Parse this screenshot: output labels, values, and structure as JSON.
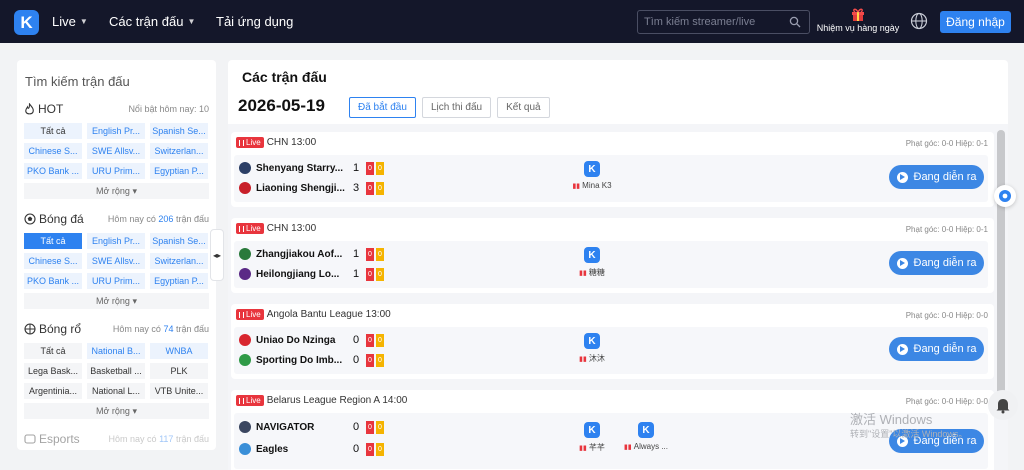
{
  "topbar": {
    "logo": "K",
    "nav": [
      {
        "label": "Live",
        "dropdown": true
      },
      {
        "label": "Các trận đấu",
        "dropdown": true
      },
      {
        "label": "Tải ứng dụng",
        "dropdown": false
      }
    ],
    "search_placeholder": "Tìm kiếm streamer/live",
    "mission_label": "Nhiệm vụ hàng ngày",
    "login_label": "Đăng nhập",
    "icons": [
      "search-icon",
      "gift-icon",
      "globe-icon"
    ]
  },
  "sidebar": {
    "title": "Tìm kiếm trận đấu",
    "sections": {
      "hot": {
        "name": "HOT",
        "note": "Nổi bật hôm nay: 10",
        "chips": [
          "Tất cả",
          "English Pr...",
          "Spanish Se...",
          "Chinese S...",
          "SWE Allsv...",
          "Switzerlan...",
          "PKO Bank ...",
          "URU Prim...",
          "Egyptian P..."
        ],
        "more": "Mở rộng"
      },
      "football": {
        "name": "Bóng đá",
        "note_prefix": "Hôm nay có",
        "count": "206",
        "note_suffix": "trận đấu",
        "chips": [
          "Tất cả",
          "English Pr...",
          "Spanish Se...",
          "Chinese S...",
          "SWE Allsv...",
          "Switzerlan...",
          "PKO Bank ...",
          "URU Prim...",
          "Egyptian P..."
        ],
        "more": "Mở rộng"
      },
      "basketball": {
        "name": "Bóng rổ",
        "note_prefix": "Hôm nay có",
        "count": "74",
        "note_suffix": "trận đấu",
        "chips": [
          "Tất cả",
          "National B...",
          "WNBA",
          "Lega Bask...",
          "Basketball ...",
          "PLK",
          "Argentinia...",
          "National L...",
          "VTB Unite..."
        ],
        "more": "Mở rộng"
      },
      "esports": {
        "name": "Esports",
        "note_prefix": "Hôm nay có",
        "count": "117",
        "note_suffix": "trận đấu"
      }
    }
  },
  "main": {
    "heading": "Các trận đấu",
    "date": "2026-05-19",
    "tabs": [
      "Đã bắt đầu",
      "Lịch thi đấu",
      "Kết quả"
    ],
    "live_badge": "Live",
    "watch_label": "Đang diễn ra",
    "matches": [
      {
        "league": "CHN 13:00",
        "odds": "Phạt góc: 0-0 Hiệp: 0-1",
        "home": {
          "name": "Shenyang Starry...",
          "score": "1",
          "red": "0",
          "yellow": "0",
          "color": "#2c3f66"
        },
        "away": {
          "name": "Liaoning Shengji...",
          "score": "3",
          "red": "0",
          "yellow": "0",
          "color": "#c8202a"
        },
        "streamers": [
          "Mina K3"
        ]
      },
      {
        "league": "CHN 13:00",
        "odds": "Phạt góc: 0-0 Hiệp: 0-1",
        "home": {
          "name": "Zhangjiakou Aof...",
          "score": "1",
          "red": "0",
          "yellow": "0",
          "color": "#2a7a3b"
        },
        "away": {
          "name": "Heilongjiang Lo...",
          "score": "1",
          "red": "0",
          "yellow": "0",
          "color": "#5b2a86"
        },
        "streamers": [
          "糖糖"
        ]
      },
      {
        "league": "Angola Bantu League 13:00",
        "odds": "Phạt góc: 0-0 Hiệp: 0-0",
        "home": {
          "name": "Uniao Do Nzinga",
          "score": "0",
          "red": "0",
          "yellow": "0",
          "color": "#d8262f"
        },
        "away": {
          "name": "Sporting Do Imb...",
          "score": "0",
          "red": "0",
          "yellow": "0",
          "color": "#2f9a47"
        },
        "streamers": [
          "沐沐"
        ]
      },
      {
        "league": "Belarus League Region A 14:00",
        "odds": "Phạt góc: 0-0 Hiệp: 0-0",
        "home": {
          "name": "NAVIGATOR",
          "score": "0",
          "red": "0",
          "yellow": "0",
          "color": "#3a4660"
        },
        "away": {
          "name": "Eagles",
          "score": "0",
          "red": "0",
          "yellow": "0",
          "color": "#3a8fd8"
        },
        "streamers": [
          "芊芊",
          "Always ..."
        ]
      }
    ]
  },
  "watermark": {
    "line1": "激活 Windows",
    "line2": "转到\"设置\"以激活 Windows。"
  },
  "colors": {
    "topbar": "#14172a",
    "accent": "#2e82f0",
    "live": "#e8353d",
    "card_yellow": "#f5b400"
  }
}
